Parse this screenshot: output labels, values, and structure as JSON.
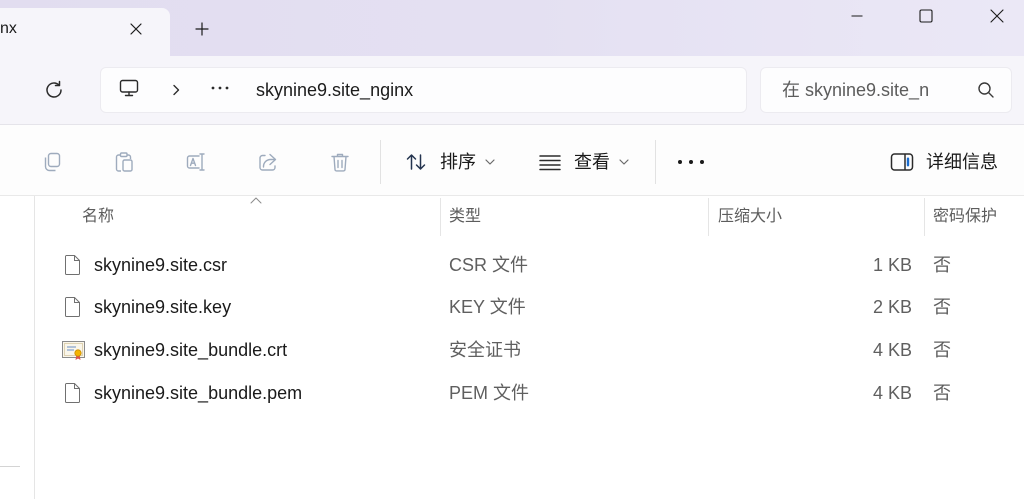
{
  "window": {
    "tab_title": "nx",
    "tab_close_icon": "close-icon",
    "new_tab_icon": "plus-icon",
    "controls": [
      "minimize-icon",
      "maximize-icon",
      "close-icon"
    ]
  },
  "navigation": {
    "refresh_icon": "refresh-icon",
    "location_icon": "computer-icon",
    "separator_icon": "chevron-right-icon",
    "overflow_icon": "ellipsis-icon",
    "current_folder": "skynine9.site_nginx"
  },
  "search": {
    "placeholder": "在 skynine9.site_n",
    "icon": "search-icon"
  },
  "toolbar": {
    "disabled_actions": [
      "copy-icon",
      "paste-icon",
      "rename-icon",
      "share-icon",
      "delete-icon"
    ],
    "sort_label": "排序",
    "sort_icon": "sort-icon",
    "view_label": "查看",
    "view_icon": "list-view-icon",
    "more_icon": "ellipsis-icon",
    "details_label": "详细信息",
    "details_icon": "details-pane-icon"
  },
  "columns": {
    "name": "名称",
    "type": "类型",
    "compressed_size": "压缩大小",
    "password_protected": "密码保护",
    "sort_icon": "chevron-up-icon"
  },
  "files": [
    {
      "name": "skynine9.site.csr",
      "type": "CSR 文件",
      "compressed_size": "1 KB",
      "password_protected": "否",
      "icon": "file-icon"
    },
    {
      "name": "skynine9.site.key",
      "type": "KEY 文件",
      "compressed_size": "2 KB",
      "password_protected": "否",
      "icon": "file-icon"
    },
    {
      "name": "skynine9.site_bundle.crt",
      "type": "安全证书",
      "compressed_size": "4 KB",
      "password_protected": "否",
      "icon": "certificate-icon"
    },
    {
      "name": "skynine9.site_bundle.pem",
      "type": "PEM 文件",
      "compressed_size": "4 KB",
      "password_protected": "否",
      "icon": "file-icon"
    }
  ],
  "colors": {
    "titlebar": "#e4e0f2",
    "chrome_background": "#f6f5fa",
    "accent": "#1a6dd0",
    "text_primary": "#1a1a1a",
    "text_secondary": "#5f5f5f",
    "icon_disabled": "#9eabbd"
  }
}
